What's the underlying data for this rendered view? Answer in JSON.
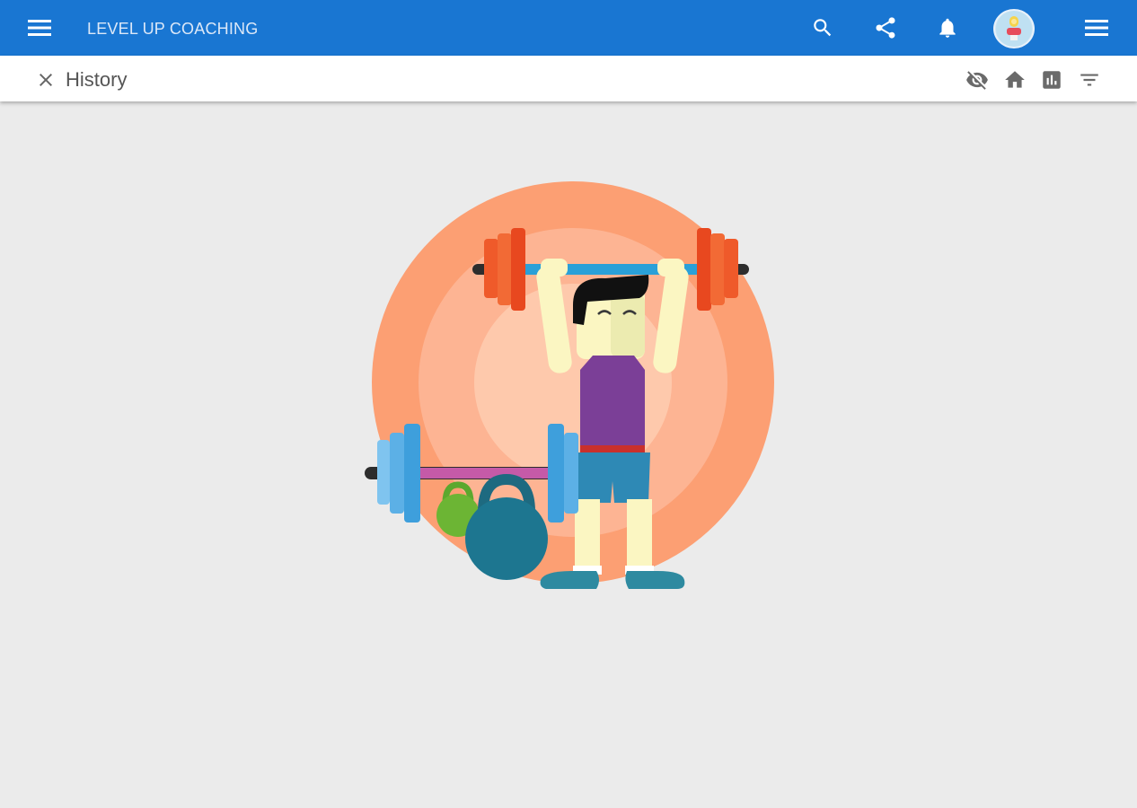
{
  "app": {
    "title": "LEVEL UP COACHING"
  },
  "appbar_icons": {
    "menu_left": "menu-icon",
    "search": "search-icon",
    "share": "share-icon",
    "notifications": "bell-icon",
    "avatar": "avatar",
    "menu_right": "menu-icon"
  },
  "subbar": {
    "title": "History",
    "icons": [
      "close-icon",
      "visibility-off-icon",
      "home-icon",
      "chart-icon",
      "filter-icon"
    ]
  },
  "colors": {
    "primary": "#1976d2",
    "background": "#ebebeb",
    "circle_outer": "#fc9f73",
    "circle_mid": "#fdb493",
    "circle_inner": "#fec9ac"
  }
}
